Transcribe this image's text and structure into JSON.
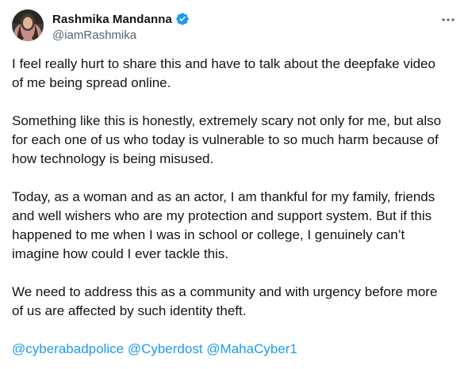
{
  "author": {
    "display_name": "Rashmika Mandanna",
    "handle": "@iamRashmika",
    "avatar_icon": "profile-photo",
    "verified_icon": "verified-badge-icon",
    "verified_color": "#1d9bf0"
  },
  "menu": {
    "icon": "more-horizontal-icon"
  },
  "tweet": {
    "paragraphs": [
      "I feel really hurt to share this and have to talk about the deepfake video\nof me being spread online.",
      "Something like this is honestly, extremely scary not only for me, but also\nfor each one of us who today is vulnerable to so much harm because of\nhow technology is being misused.",
      "Today, as a woman and as an actor, I am thankful for my family, friends\nand well wishers who are my protection and support system. But if this\nhappened to me when I was in school or college, I genuinely can’t\nimagine how could I ever tackle this.",
      "We need to address this as a community and with urgency before more\nof us are affected by such identity theft."
    ],
    "mentions": [
      "@cyberabadpolice",
      "@Cyberdost",
      "@MahaCyber1"
    ],
    "mention_color": "#1d9bf0"
  }
}
